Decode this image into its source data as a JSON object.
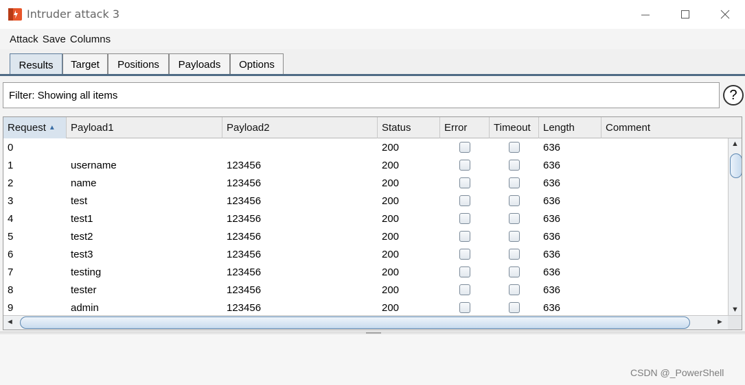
{
  "window": {
    "title": "Intruder attack 3",
    "controls": {
      "minimize": "—",
      "maximize": "☐",
      "close": "✕"
    },
    "icon_color": "#e8562a"
  },
  "menu": [
    "Attack",
    "Save",
    "Columns"
  ],
  "tabs": [
    {
      "label": "Results",
      "active": true
    },
    {
      "label": "Target",
      "active": false
    },
    {
      "label": "Positions",
      "active": false
    },
    {
      "label": "Payloads",
      "active": false
    },
    {
      "label": "Options",
      "active": false
    }
  ],
  "filter": {
    "text": "Filter: Showing all items",
    "help": "?"
  },
  "table": {
    "columns": [
      "Request",
      "Payload1",
      "Payload2",
      "Status",
      "Error",
      "Timeout",
      "Length",
      "Comment"
    ],
    "sort_indicator": "▲",
    "rows": [
      {
        "request": "0",
        "payload1": "",
        "payload2": "",
        "status": "200",
        "length": "636",
        "comment": ""
      },
      {
        "request": "1",
        "payload1": "username",
        "payload2": "123456",
        "status": "200",
        "length": "636",
        "comment": ""
      },
      {
        "request": "2",
        "payload1": "name",
        "payload2": "123456",
        "status": "200",
        "length": "636",
        "comment": ""
      },
      {
        "request": "3",
        "payload1": "test",
        "payload2": "123456",
        "status": "200",
        "length": "636",
        "comment": ""
      },
      {
        "request": "4",
        "payload1": "test1",
        "payload2": "123456",
        "status": "200",
        "length": "636",
        "comment": ""
      },
      {
        "request": "5",
        "payload1": "test2",
        "payload2": "123456",
        "status": "200",
        "length": "636",
        "comment": ""
      },
      {
        "request": "6",
        "payload1": "test3",
        "payload2": "123456",
        "status": "200",
        "length": "636",
        "comment": ""
      },
      {
        "request": "7",
        "payload1": "testing",
        "payload2": "123456",
        "status": "200",
        "length": "636",
        "comment": ""
      },
      {
        "request": "8",
        "payload1": "tester",
        "payload2": "123456",
        "status": "200",
        "length": "636",
        "comment": ""
      },
      {
        "request": "9",
        "payload1": "admin",
        "payload2": "123456",
        "status": "200",
        "length": "636",
        "comment": ""
      }
    ]
  },
  "scroll": {
    "up": "▲",
    "down": "▼",
    "left": "◄",
    "right": "►"
  },
  "watermark": "CSDN @_PowerShell"
}
